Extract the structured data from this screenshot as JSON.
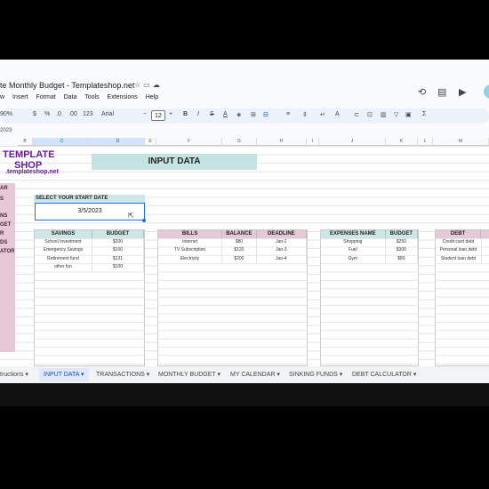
{
  "window": {
    "title": "te Monthly Budget - Templateshop.net"
  },
  "menu": [
    "w",
    "Insert",
    "Format",
    "Data",
    "Tools",
    "Extensions",
    "Help"
  ],
  "toolbar": {
    "zoom": "90%",
    "currency": "$",
    "percent": "%",
    "dec": ".0",
    "dec2": ".00",
    "fmt": "123",
    "font": "Arial",
    "size": "12",
    "minus": "−",
    "plus": "+",
    "bold": "B",
    "italic": "I",
    "strike": "S",
    "textcolor": "A"
  },
  "namebox": "2023",
  "columns": [
    "B",
    "C",
    "D",
    "E",
    "F",
    "G",
    "H",
    "I",
    "J",
    "K",
    "L",
    "M"
  ],
  "brand": {
    "line1": "TEMPLATE",
    "line2": "SHOP",
    "url": ".templateshop.net"
  },
  "leftnav": [
    "AR",
    "S",
    "NS",
    "GET",
    "R",
    "DS",
    "ATOR"
  ],
  "banner": "INPUT DATA",
  "start": {
    "label": "SELECT YOUR START DATE",
    "value": "3/5/2023"
  },
  "savings": {
    "headers": [
      "SAVINGS",
      "BUDGET"
    ],
    "rows": [
      [
        "School Investment",
        "$200"
      ],
      [
        "Emergency Savings",
        "$100"
      ],
      [
        "Retirement fund",
        "$131"
      ],
      [
        "other fun",
        "$100"
      ]
    ]
  },
  "bills": {
    "headers": [
      "BILLS",
      "BALANCE",
      "DEADLINE"
    ],
    "rows": [
      [
        "Internet",
        "$80",
        "Jan-2"
      ],
      [
        "TV Subscription",
        "$120",
        "Jan-3"
      ],
      [
        "Electricity",
        "$200",
        "Jan-4"
      ]
    ]
  },
  "expenses": {
    "headers": [
      "EXPENSES NAME",
      "BUDGET"
    ],
    "rows": [
      [
        "Shopping",
        "$250"
      ],
      [
        "Fuel",
        "$300"
      ],
      [
        "Gym",
        "$80"
      ]
    ]
  },
  "debt": {
    "headers": [
      "DEBT"
    ],
    "rows": [
      [
        "Credit card debt"
      ],
      [
        "Personal loan debt"
      ],
      [
        "Student loan debt"
      ]
    ]
  },
  "tabs": [
    "tructions",
    "INPUT DATA",
    "TRANSACTIONS",
    "MONTHLY BUDGET",
    "MY CALENDAR",
    "SINKING FUNDS",
    "DEBT CALCULATOR"
  ],
  "colors": {
    "teal": "#c6e3e3",
    "pink": "#e6c9d6",
    "purple": "#6a1b9a",
    "accent": "#1a73e8"
  }
}
